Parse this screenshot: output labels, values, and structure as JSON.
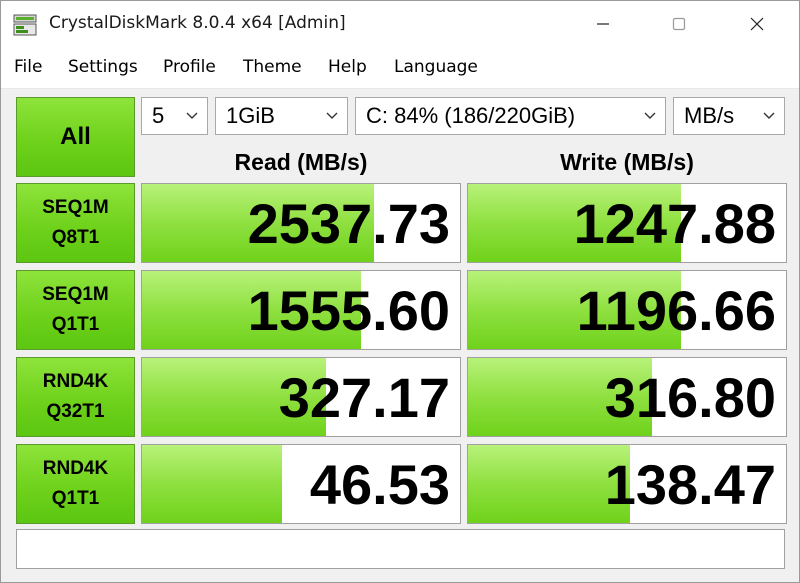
{
  "window": {
    "title": "CrystalDiskMark 8.0.4 x64 [Admin]"
  },
  "menu": {
    "items": [
      "File",
      "Settings",
      "Profile",
      "Theme",
      "Help",
      "Language"
    ]
  },
  "controls": {
    "all_label": "All",
    "count": "5",
    "size": "1GiB",
    "drive": "C: 84% (186/220GiB)",
    "unit": "MB/s"
  },
  "columns": {
    "read": "Read (MB/s)",
    "write": "Write (MB/s)"
  },
  "rows": [
    {
      "line1": "SEQ1M",
      "line2": "Q8T1",
      "read": "2537.73",
      "write": "1247.88",
      "read_fill": 0.73,
      "write_fill": 0.67
    },
    {
      "line1": "SEQ1M",
      "line2": "Q1T1",
      "read": "1555.60",
      "write": "1196.66",
      "read_fill": 0.69,
      "write_fill": 0.67
    },
    {
      "line1": "RND4K",
      "line2": "Q32T1",
      "read": "327.17",
      "write": "316.80",
      "read_fill": 0.58,
      "write_fill": 0.58
    },
    {
      "line1": "RND4K",
      "line2": "Q1T1",
      "read": "46.53",
      "write": "138.47",
      "read_fill": 0.44,
      "write_fill": 0.51
    }
  ],
  "status": {
    "text": ""
  },
  "colors": {
    "accent_green": "#6fd21b",
    "bar_green_light": "#b8f27a"
  },
  "icons": {
    "app": "crystaldiskmark-icon",
    "minimize": "minimize-icon",
    "maximize": "maximize-icon",
    "close": "close-icon",
    "dropdown": "chevron-down-icon"
  }
}
